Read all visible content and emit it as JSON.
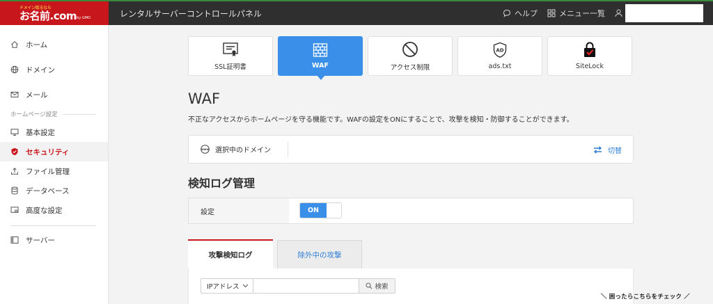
{
  "brand": {
    "tagline": "ドメイン取るなら",
    "name": "お名前.com",
    "sub": "by GMO"
  },
  "header": {
    "title": "レンタルサーバーコントロールパネル",
    "help": "ヘルプ",
    "menu": "メニュー一覧"
  },
  "sidebar": {
    "home": "ホーム",
    "domain": "ドメイン",
    "mail": "メール",
    "section_homepage": "ホームページ設定",
    "basic": "基本設定",
    "security": "セキュリティ",
    "files": "ファイル管理",
    "database": "データベース",
    "advanced": "高度な設定",
    "server": "サーバー"
  },
  "feature_tabs": {
    "ssl": "SSL証明書",
    "waf": "WAF",
    "access": "アクセス制限",
    "ads": "ads.txt",
    "sitelock": "SiteLock"
  },
  "page": {
    "title": "WAF",
    "description": "不正なアクセスからホームページを守る機能です。WAFの設定をONにすることで、攻撃を検知・防御することができます。"
  },
  "domain_box": {
    "label": "選択中のドメイン",
    "switch": "切替"
  },
  "log_section": {
    "title": "検知ログ管理",
    "setting_label": "設定",
    "toggle_on": "ON"
  },
  "log_tabs": {
    "detected": "攻撃検知ログ",
    "excluded": "除外中の攻撃"
  },
  "search": {
    "select_value": "IPアドレス",
    "input_value": "",
    "button": "検索"
  },
  "help_link": "＼ 困ったらこちらをチェック ／",
  "colors": {
    "brand_red": "#c8161d",
    "accent_blue": "#3a8fe8",
    "topbar": "#2f2f2f"
  }
}
